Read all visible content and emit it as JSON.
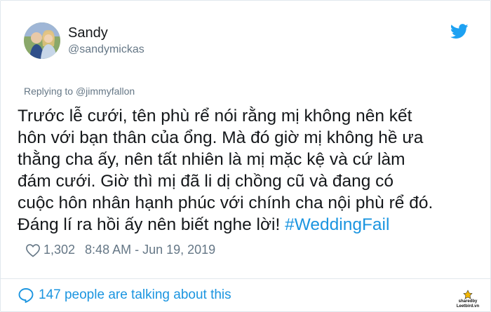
{
  "tweet": {
    "author_name": "Sandy",
    "author_handle": "@sandymickas",
    "replying_prefix": "Replying to ",
    "replying_to": "@jimmyfallon",
    "body_lines": [
      "Trước lễ cưới, tên phù rể nói rằng mị không nên kết",
      "hôn với bạn thân của ổng. Mà đó giờ mị không hề ưa",
      "thằng cha ấy, nên tất nhiên là mị mặc kệ và cứ làm",
      "đám cưới. Giờ thì mị đã li dị chồng cũ và đang có",
      "cuộc hôn nhân hạnh phúc với chính cha nội phù rể đó.",
      "Đáng lí ra hồi ấy nên biết nghe lời! "
    ],
    "hashtag": "#WeddingFail",
    "likes": "1,302",
    "timestamp": "8:48 AM - Jun 19, 2019",
    "talking": "147 people are talking about this"
  },
  "watermark": {
    "line1": "sharedby",
    "line2": "Leetbird.vn"
  },
  "colors": {
    "text": "#14171a",
    "secondary": "#657786",
    "link": "#1b95e0",
    "twitter_blue": "#1da1f2",
    "border": "#e1e8ed"
  },
  "icons": {
    "brand": "twitter-bird-icon",
    "like": "heart-icon",
    "talking": "speech-bubble-icon"
  }
}
